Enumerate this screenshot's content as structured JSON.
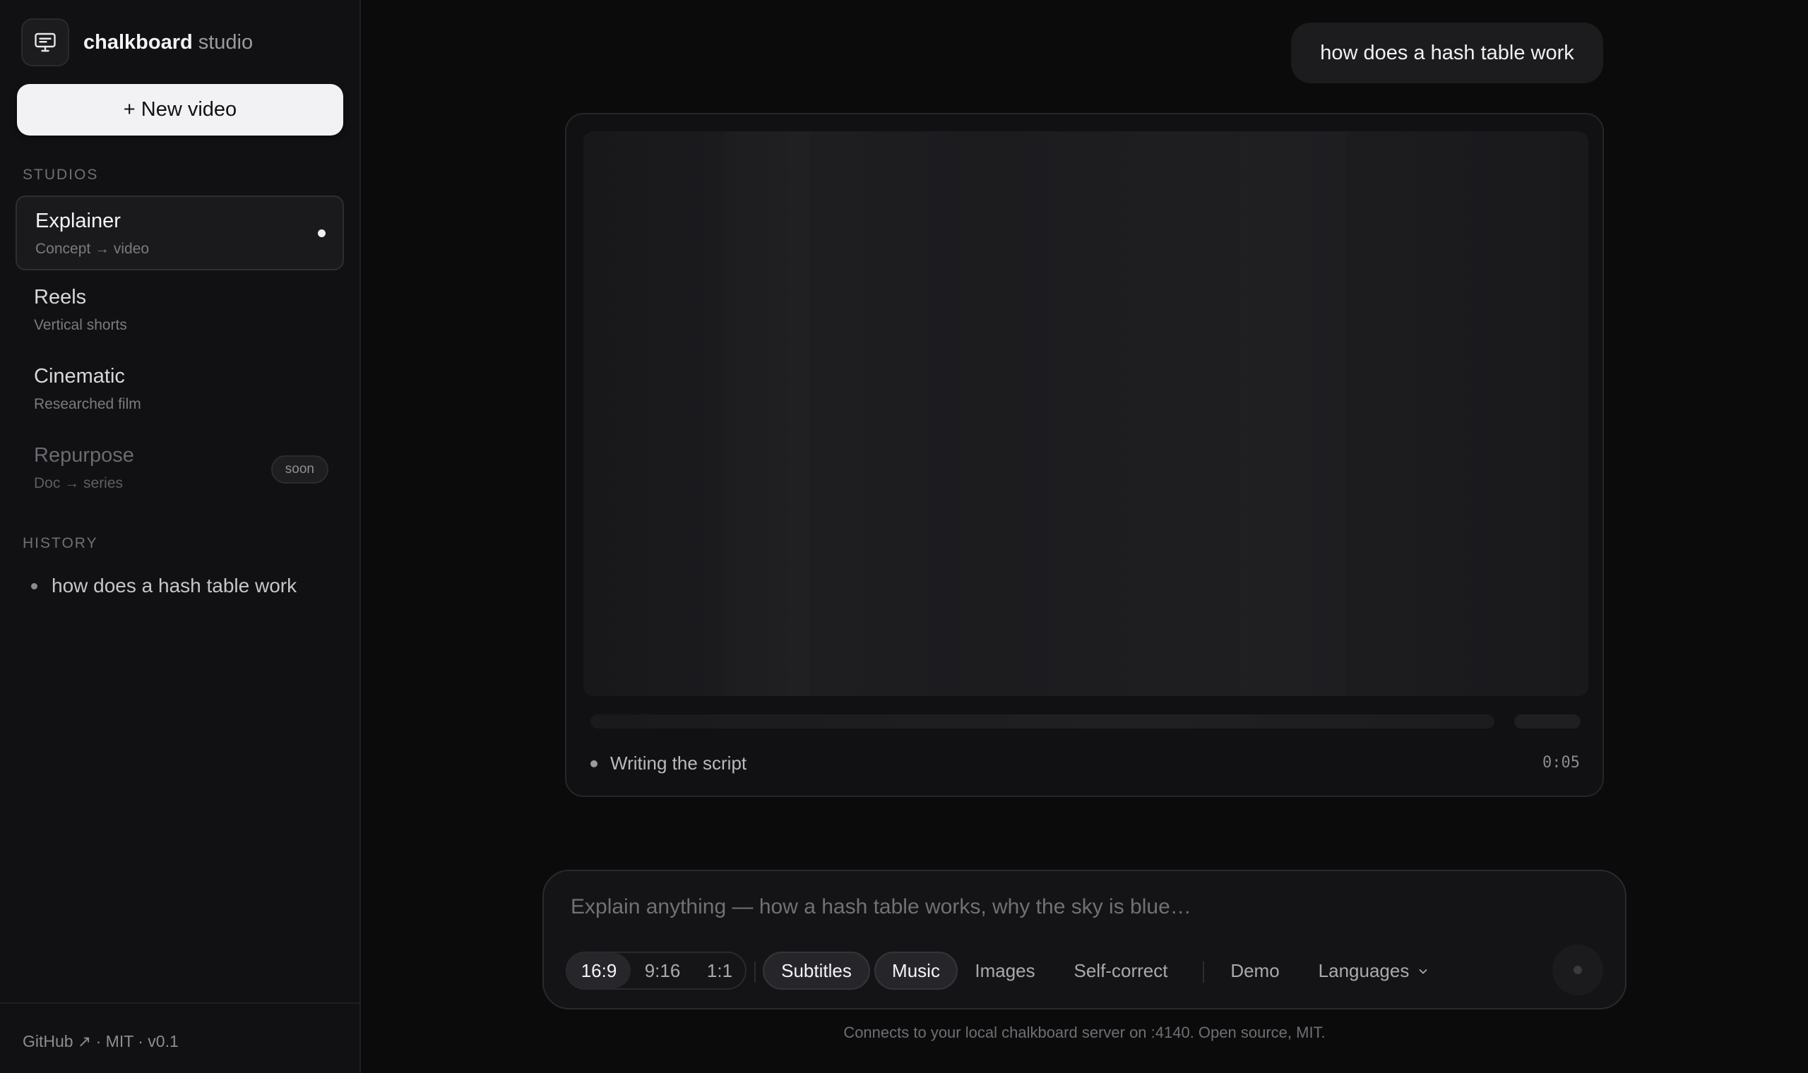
{
  "brand": {
    "name": "chalkboard",
    "suffix": "studio",
    "logo_icon": "monitor-icon"
  },
  "sidebar": {
    "new_video_label": "+ New video",
    "studios_label": "STUDIOS",
    "studios": [
      {
        "title": "Explainer",
        "desc": "Concept → video",
        "active": true
      },
      {
        "title": "Reels",
        "desc": "Vertical shorts"
      },
      {
        "title": "Cinematic",
        "desc": "Researched film"
      },
      {
        "title": "Repurpose",
        "desc": "Doc → series",
        "badge": "soon",
        "disabled": true
      }
    ],
    "history_label": "HISTORY",
    "history": [
      "how does a hash table work"
    ],
    "footer": "GitHub ↗ · MIT · v0.1"
  },
  "conversation": {
    "user_message": "how does a hash table work",
    "status_text": "Writing the script",
    "timer": "0:05",
    "progress": 0.0
  },
  "composer": {
    "placeholder": "Explain anything — how a hash table works, why the sky is blue…",
    "aspect_options": [
      "16:9",
      "9:16",
      "1:1"
    ],
    "aspect_selected": "16:9",
    "toggles": [
      {
        "label": "Subtitles",
        "on": true
      },
      {
        "label": "Music",
        "on": true
      },
      {
        "label": "Images",
        "on": false
      },
      {
        "label": "Self-correct",
        "on": false
      }
    ],
    "demo_label": "Demo",
    "languages_label": "Languages",
    "disclaimer": "Connects to your local chalkboard server on :4140. Open source, MIT."
  }
}
